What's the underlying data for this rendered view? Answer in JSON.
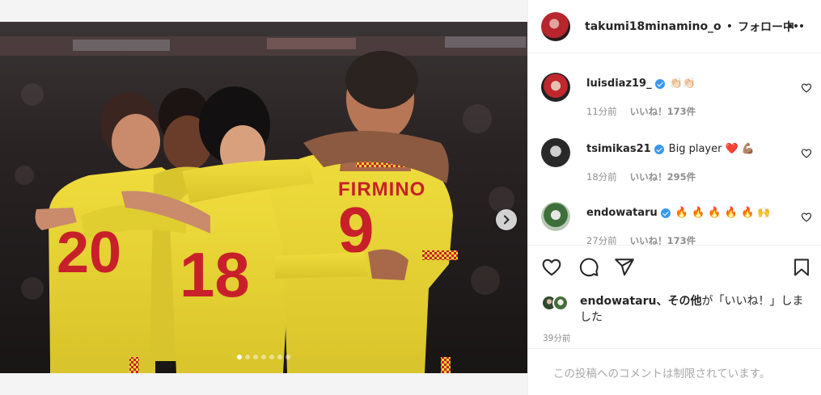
{
  "post": {
    "author": "takumi18minamino_o",
    "separator": "•",
    "follow_status": "フォロー中",
    "more_icon": "more-horizontal-icon",
    "image": {
      "jerseys": [
        "20",
        "18",
        "9"
      ],
      "name_on_back": "FIRMINO",
      "carousel_total": 7,
      "carousel_active": 1
    }
  },
  "comments": [
    {
      "user": "luisdiaz19_",
      "verified": true,
      "text": "👏🏻👏🏻",
      "time": "11分前",
      "likes": "いいね！173件"
    },
    {
      "user": "tsimikas21",
      "verified": true,
      "text": "Big player ❤️ 💪🏽",
      "time": "18分前",
      "likes": "いいね！295件"
    },
    {
      "user": "endowataru",
      "verified": true,
      "text": "🔥 🔥 🔥 🔥 🔥 🙌",
      "time": "27分前",
      "likes": "いいね！173件"
    }
  ],
  "actions": {
    "like": "heart-icon",
    "comment": "comment-icon",
    "share": "send-icon",
    "save": "bookmark-icon"
  },
  "liked_by": {
    "name": "endowataru",
    "others": "、その他",
    "suffix": "が「いいね！」しました"
  },
  "posted_time": "39分前",
  "comments_restricted": "この投稿へのコメントは制限されています。",
  "colors": {
    "kit_yellow": "#e8d635",
    "kit_red": "#c8202a",
    "verified": "#3897f0",
    "muted": "#8e8e8e"
  }
}
